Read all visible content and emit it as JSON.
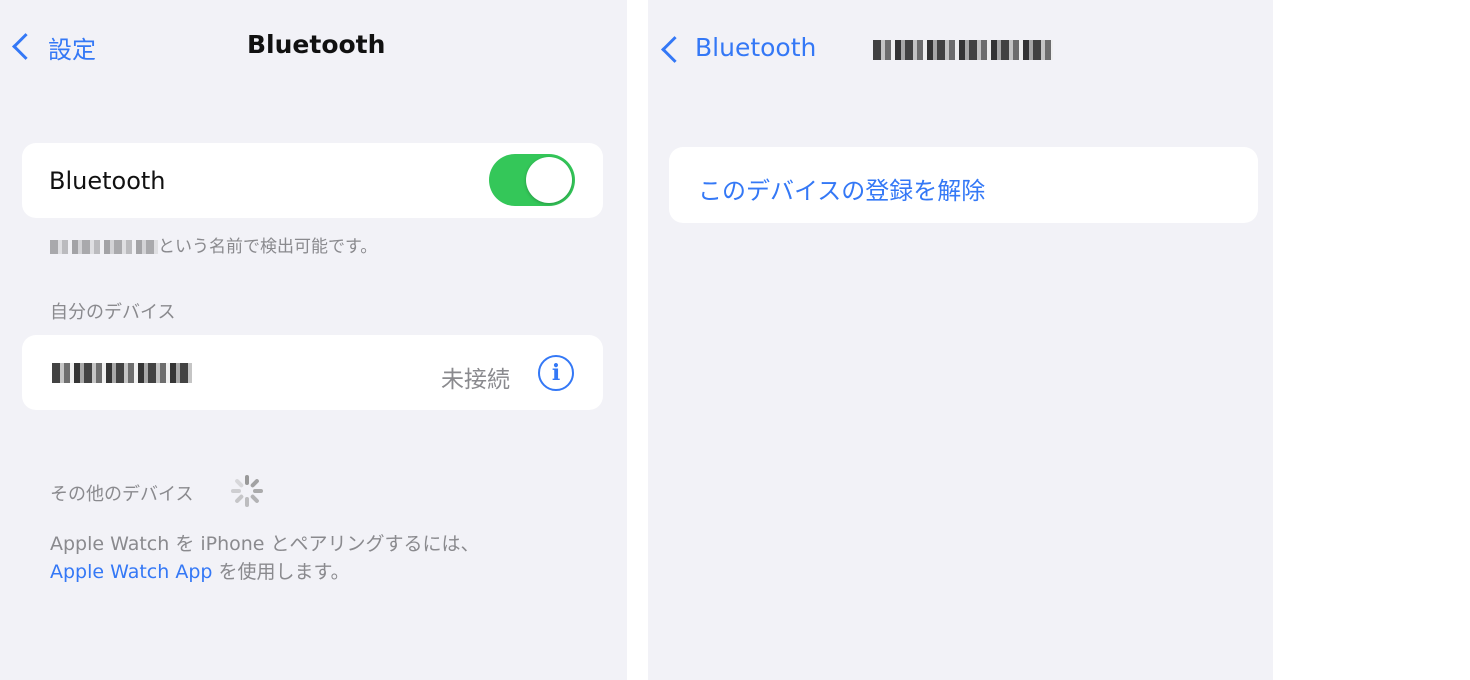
{
  "left": {
    "back_label": "設定",
    "title": "Bluetooth",
    "bluetooth_row_label": "Bluetooth",
    "bluetooth_enabled": true,
    "discoverable_suffix": "という名前で検出可能です。",
    "my_devices_header": "自分のデバイス",
    "device_status": "未接続",
    "other_devices_header": "その他のデバイス",
    "watch_note_line1": "Apple Watch を iPhone とペアリングするには、",
    "watch_app_link": "Apple Watch App",
    "watch_note_line2_suffix": " を使用します。",
    "colors": {
      "accent": "#3478f6",
      "toggle_on": "#34c759",
      "background": "#f2f2f7"
    }
  },
  "right": {
    "back_label": "Bluetooth",
    "forget_device_label": "このデバイスの登録を解除"
  }
}
